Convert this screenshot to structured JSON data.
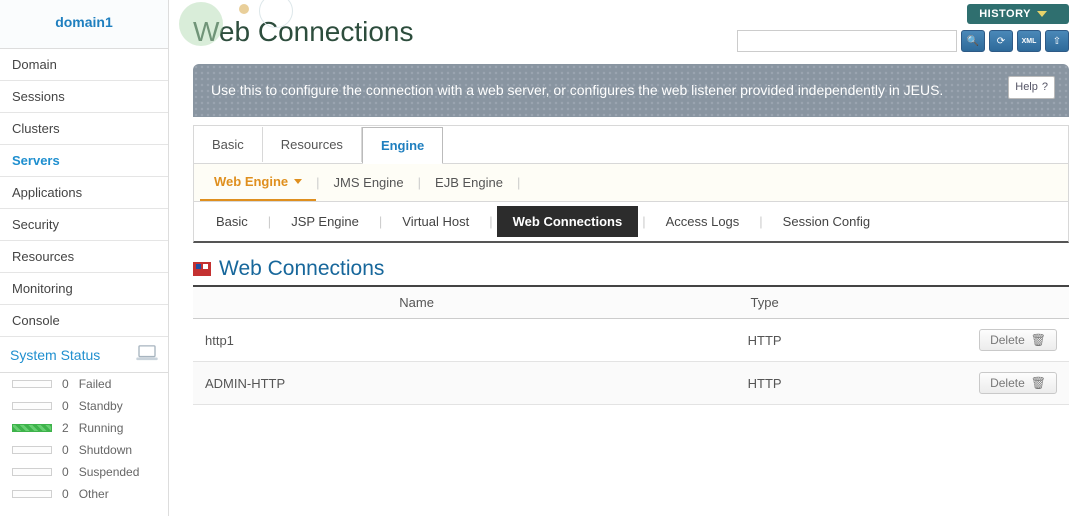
{
  "domain_title": "domain1",
  "sidebar": {
    "items": [
      {
        "label": "Domain"
      },
      {
        "label": "Sessions"
      },
      {
        "label": "Clusters"
      },
      {
        "label": "Servers",
        "active": true
      },
      {
        "label": "Applications"
      },
      {
        "label": "Security"
      },
      {
        "label": "Resources"
      },
      {
        "label": "Monitoring"
      },
      {
        "label": "Console"
      }
    ]
  },
  "system_status": {
    "title": "System Status",
    "rows": [
      {
        "count": "0",
        "label": "Failed"
      },
      {
        "count": "0",
        "label": "Standby"
      },
      {
        "count": "2",
        "label": "Running",
        "filled": true
      },
      {
        "count": "0",
        "label": "Shutdown"
      },
      {
        "count": "0",
        "label": "Suspended"
      },
      {
        "count": "0",
        "label": "Other"
      }
    ]
  },
  "header": {
    "history_label": "HISTORY",
    "search_placeholder": ""
  },
  "page_title": "Web Connections",
  "banner_text": "Use this to configure the connection with a web server, or configures the web listener provided independently in JEUS.",
  "help_label": "Help",
  "tabs": [
    "Basic",
    "Resources",
    "Engine"
  ],
  "tabs_active": 2,
  "subtabs": [
    "Web Engine",
    "JMS Engine",
    "EJB Engine"
  ],
  "subtabs_active": 0,
  "subtabs2": [
    "Basic",
    "JSP Engine",
    "Virtual Host",
    "Web Connections",
    "Access Logs",
    "Session Config"
  ],
  "subtabs2_active": 3,
  "section_title": "Web Connections",
  "table": {
    "columns": [
      "Name",
      "Type"
    ],
    "rows": [
      {
        "name": "http1",
        "type": "HTTP"
      },
      {
        "name": "ADMIN-HTTP",
        "type": "HTTP"
      }
    ],
    "delete_label": "Delete"
  }
}
